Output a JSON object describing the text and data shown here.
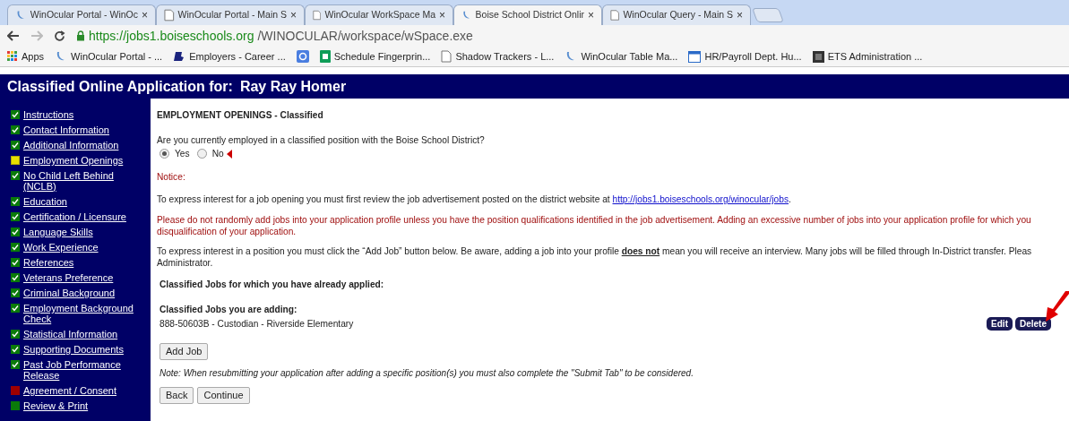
{
  "browser": {
    "tabs": [
      {
        "title": "WinOcular Portal - WinOc",
        "kind": "logo",
        "selected": false
      },
      {
        "title": "WinOcular Portal - Main S",
        "kind": "page",
        "selected": false
      },
      {
        "title": "WinOcular WorkSpace Ma",
        "kind": "page",
        "selected": false
      },
      {
        "title": "Boise School District Onlir",
        "kind": "logo",
        "selected": true
      },
      {
        "title": "WinOcular Query - Main S",
        "kind": "page",
        "selected": false
      }
    ],
    "close_glyph": "×",
    "url_host": "https://jobs1.boiseschools.org",
    "url_path": "/WINOCULAR/workspace/wSpace.exe",
    "bookmarks": [
      {
        "label": "Apps",
        "kind": "apps"
      },
      {
        "label": "WinOcular Portal - ...",
        "kind": "logo"
      },
      {
        "label": "Employers - Career ...",
        "kind": "b"
      },
      {
        "kind": "google"
      },
      {
        "label": "Schedule Fingerprin...",
        "kind": "sheet"
      },
      {
        "label": "Shadow Trackers - L...",
        "kind": "page"
      },
      {
        "label": "WinOcular Table Ma...",
        "kind": "logo"
      },
      {
        "label": "HR/Payroll Dept. Hu...",
        "kind": "window"
      },
      {
        "label": "ETS Administration ...",
        "kind": "dark"
      }
    ]
  },
  "header": {
    "title": "Classified Online Application for:",
    "name": "Ray Ray Homer"
  },
  "sidebar": {
    "items": [
      {
        "label": "Instructions",
        "kind": "complete"
      },
      {
        "label": "Contact Information",
        "kind": "complete"
      },
      {
        "label": "Additional Information",
        "kind": "complete"
      },
      {
        "label": "Employment Openings",
        "kind": "current"
      },
      {
        "label": "No Child Left Behind (NCLB)",
        "kind": "complete"
      },
      {
        "label": "Education",
        "kind": "complete"
      },
      {
        "label": "Certification / Licensure",
        "kind": "complete"
      },
      {
        "label": "Language Skills",
        "kind": "complete"
      },
      {
        "label": "Work Experience",
        "kind": "complete"
      },
      {
        "label": "References",
        "kind": "complete"
      },
      {
        "label": "Veterans Preference",
        "kind": "complete"
      },
      {
        "label": "Criminal Background",
        "kind": "complete"
      },
      {
        "label": "Employment Background Check",
        "kind": "complete"
      },
      {
        "label": "Statistical Information",
        "kind": "complete"
      },
      {
        "label": "Supporting Documents",
        "kind": "complete"
      },
      {
        "label": "Past Job Performance Release",
        "kind": "complete"
      },
      {
        "label": "Agreement / Consent",
        "kind": "incomplete"
      },
      {
        "label": "Review & Print",
        "kind": "pending"
      }
    ]
  },
  "content": {
    "heading": "EMPLOYMENT OPENINGS - Classified",
    "question": "Are you currently employed in a classified position with the Boise School District?",
    "options": [
      {
        "label": "Yes",
        "selected": true
      },
      {
        "label": "No",
        "selected": false
      }
    ],
    "notice": "Notice:",
    "para1": "To express interest for a job opening you must first review the job advertisement posted on the district website at",
    "para1_link": "http://jobs1.boiseschools.org/winocular/jobs",
    "para1_end": ".",
    "para2_lines": [
      "Please do not randomly add jobs into your application profile unless you have the position qualifications identified in the job advertisement. Adding an excessive number of jobs into your application profile for which you",
      "disqualification of your application."
    ],
    "para3_lines": [
      "To express interest in a position you must click the “Add Job” button below. Be aware, adding a job into your profile **does not** mean you will receive an interview. Many jobs will be filled through In-District transfer. Pleas",
      "Administrator."
    ],
    "applied_heading": "Classified Jobs for which you have already applied:",
    "adding_heading": "Classified Jobs you are adding:",
    "jobs": [
      {
        "title": "888-50603B - Custodian - Riverside Elementary",
        "actions": [
          "Edit",
          "Delete"
        ]
      }
    ],
    "add_button": "Add Job",
    "note": "Note: When resubmitting your application after adding a specific position(s) you must also complete the \"Submit Tab\" to be considered.",
    "nav_buttons": [
      "Back",
      "Continue"
    ]
  }
}
